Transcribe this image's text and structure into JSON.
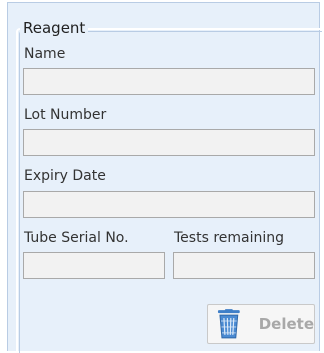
{
  "group": {
    "title": "Reagent"
  },
  "fields": {
    "name": {
      "label": "Name",
      "value": ""
    },
    "lot_number": {
      "label": "Lot Number",
      "value": ""
    },
    "expiry_date": {
      "label": "Expiry Date",
      "value": ""
    },
    "tube_serial": {
      "label": "Tube Serial No.",
      "value": ""
    },
    "tests_remaining": {
      "label": "Tests remaining",
      "value": ""
    }
  },
  "actions": {
    "delete_label": "Delete",
    "delete_icon": "trash-bin-icon",
    "delete_enabled": false
  },
  "colors": {
    "panel_background": "#e7f0fa",
    "panel_border": "#b9cce4",
    "field_background": "#f2f2f2",
    "icon_blue": "#3f7fc8",
    "disabled_text": "#a8a8a8"
  }
}
